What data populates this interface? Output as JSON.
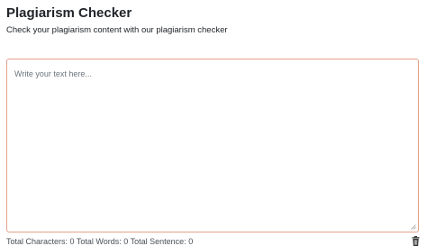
{
  "header": {
    "title": "Plagiarism Checker",
    "subtitle": "Check your plagiarism content with our plagiarism checker"
  },
  "editor": {
    "placeholder": "Write your text here...",
    "value": "",
    "border_color": "#e3a08c"
  },
  "stats": {
    "characters_label": "Total Characters:",
    "characters_value": "0",
    "words_label": "Total Words:",
    "words_value": "0",
    "sentences_label": "Total Sentence:",
    "sentences_value": "0"
  },
  "icons": {
    "clear": "trash-icon",
    "resize": "resize-grip-icon"
  }
}
